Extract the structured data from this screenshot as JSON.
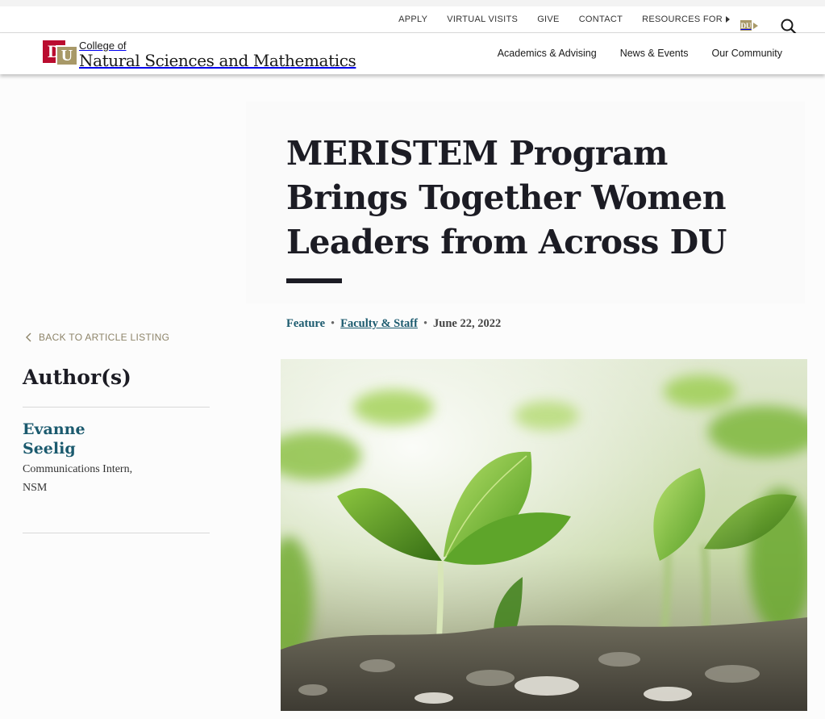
{
  "utility_nav": {
    "links": [
      "APPLY",
      "VIRTUAL VISITS",
      "GIVE",
      "CONTACT",
      "RESOURCES FOR"
    ],
    "du_label": "DU",
    "search_icon": "search-icon"
  },
  "header": {
    "logo_mark": "DU",
    "college_of": "College of",
    "college_name": "Natural Sciences and Mathematics",
    "nav": [
      "Academics & Advising",
      "News & Events",
      "Our Community"
    ]
  },
  "article": {
    "title": "MERISTEM Program Brings Together Women Leaders from Across DU",
    "category": "Feature",
    "tag": "Faculty & Staff",
    "separator": "•",
    "date": "June 22, 2022",
    "image_subject": "green seedlings sprouting from soil"
  },
  "sidebar": {
    "back_link": "BACK TO ARTICLE LISTING",
    "authors_heading": "Author(s)",
    "author_name": "Evanne Seelig",
    "author_role": "Communications Intern, NSM"
  },
  "colors": {
    "brand_red": "#ba0c2f",
    "brand_gold": "#a89968",
    "link_teal": "#1b5a6e",
    "title_dark": "#1c1c24"
  }
}
